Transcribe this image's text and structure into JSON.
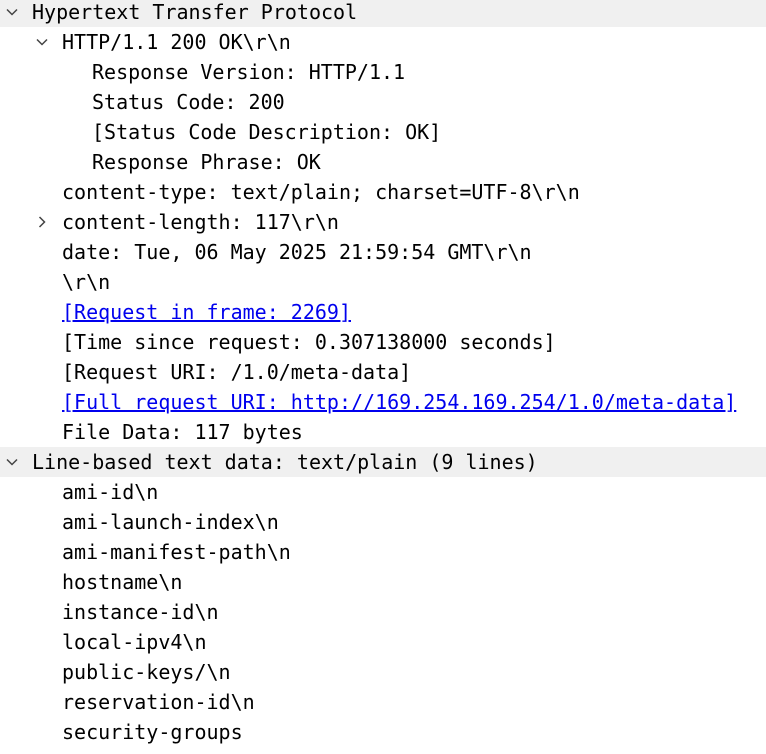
{
  "tree": {
    "rows": [
      {
        "text": "Hypertext Transfer Protocol",
        "depth": 0,
        "expander": "expanded",
        "selected": true,
        "link": false
      },
      {
        "text": "HTTP/1.1 200 OK\\r\\n",
        "depth": 1,
        "expander": "expanded",
        "selected": false,
        "link": false
      },
      {
        "text": "Response Version: HTTP/1.1",
        "depth": 2,
        "expander": "none",
        "selected": false,
        "link": false
      },
      {
        "text": "Status Code: 200",
        "depth": 2,
        "expander": "none",
        "selected": false,
        "link": false
      },
      {
        "text": "[Status Code Description: OK]",
        "depth": 2,
        "expander": "none",
        "selected": false,
        "link": false
      },
      {
        "text": "Response Phrase: OK",
        "depth": 2,
        "expander": "none",
        "selected": false,
        "link": false
      },
      {
        "text": "content-type: text/plain; charset=UTF-8\\r\\n",
        "depth": 1,
        "expander": "none",
        "selected": false,
        "link": false
      },
      {
        "text": "content-length: 117\\r\\n",
        "depth": 1,
        "expander": "collapsed",
        "selected": false,
        "link": false
      },
      {
        "text": "date: Tue, 06 May 2025 21:59:54 GMT\\r\\n",
        "depth": 1,
        "expander": "none",
        "selected": false,
        "link": false
      },
      {
        "text": "\\r\\n",
        "depth": 1,
        "expander": "none",
        "selected": false,
        "link": false
      },
      {
        "text": "[Request in frame: 2269]",
        "depth": 1,
        "expander": "none",
        "selected": false,
        "link": true
      },
      {
        "text": "[Time since request: 0.307138000 seconds]",
        "depth": 1,
        "expander": "none",
        "selected": false,
        "link": false
      },
      {
        "text": "[Request URI: /1.0/meta-data]",
        "depth": 1,
        "expander": "none",
        "selected": false,
        "link": false
      },
      {
        "text": "[Full request URI: http://169.254.169.254/1.0/meta-data]",
        "depth": 1,
        "expander": "none",
        "selected": false,
        "link": true
      },
      {
        "text": "File Data: 117 bytes",
        "depth": 1,
        "expander": "none",
        "selected": false,
        "link": false
      },
      {
        "text": "Line-based text data: text/plain (9 lines)",
        "depth": 0,
        "expander": "expanded",
        "selected": true,
        "link": false
      },
      {
        "text": "ami-id\\n",
        "depth": 1,
        "expander": "none",
        "selected": false,
        "link": false
      },
      {
        "text": "ami-launch-index\\n",
        "depth": 1,
        "expander": "none",
        "selected": false,
        "link": false
      },
      {
        "text": "ami-manifest-path\\n",
        "depth": 1,
        "expander": "none",
        "selected": false,
        "link": false
      },
      {
        "text": "hostname\\n",
        "depth": 1,
        "expander": "none",
        "selected": false,
        "link": false
      },
      {
        "text": "instance-id\\n",
        "depth": 1,
        "expander": "none",
        "selected": false,
        "link": false
      },
      {
        "text": "local-ipv4\\n",
        "depth": 1,
        "expander": "none",
        "selected": false,
        "link": false
      },
      {
        "text": "public-keys/\\n",
        "depth": 1,
        "expander": "none",
        "selected": false,
        "link": false
      },
      {
        "text": "reservation-id\\n",
        "depth": 1,
        "expander": "none",
        "selected": false,
        "link": false
      },
      {
        "text": "security-groups",
        "depth": 1,
        "expander": "none",
        "selected": false,
        "link": false
      }
    ]
  },
  "colors": {
    "text": "#000000",
    "link": "#0000ee",
    "selected_row_background": "#f0f0f0",
    "expander": "#444444"
  },
  "icons": {
    "expanded": "chevron-down-icon",
    "collapsed": "chevron-right-icon"
  }
}
